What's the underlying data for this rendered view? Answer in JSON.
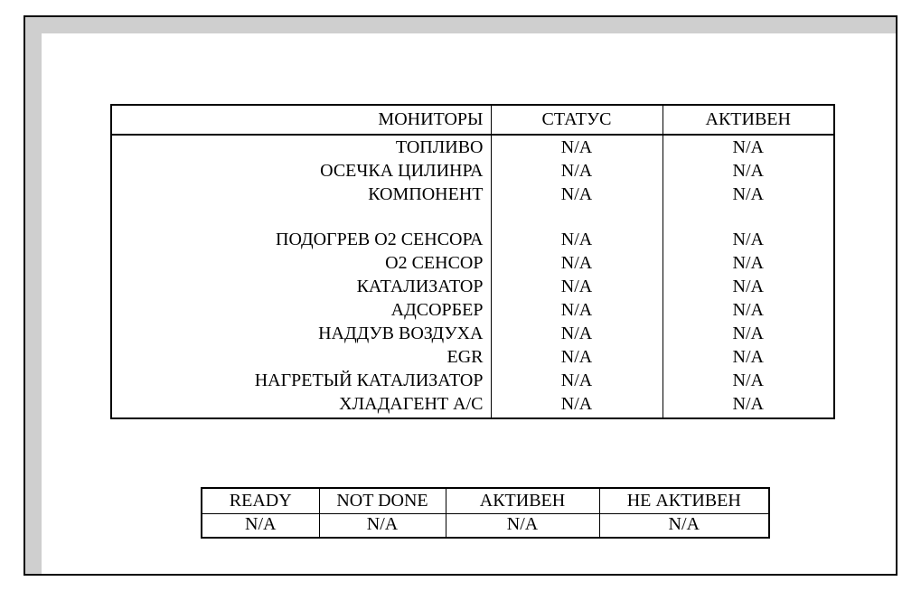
{
  "monitors": {
    "headers": {
      "name": "МОНИТОРЫ",
      "status": "СТАТУС",
      "active": "АКТИВЕН"
    },
    "rows_group1": [
      {
        "name": "ТОПЛИВО",
        "status": "N/A",
        "active": "N/A"
      },
      {
        "name": "ОСЕЧКА ЦИЛИНРА",
        "status": "N/A",
        "active": "N/A"
      },
      {
        "name": "КОМПОНЕНТ",
        "status": "N/A",
        "active": "N/A"
      }
    ],
    "rows_group2": [
      {
        "name": "ПОДОГРЕВ О2 СЕНСОРА",
        "status": "N/A",
        "active": "N/A"
      },
      {
        "name": "О2 СЕНСОР",
        "status": "N/A",
        "active": "N/A"
      },
      {
        "name": "КАТАЛИЗАТОР",
        "status": "N/A",
        "active": "N/A"
      },
      {
        "name": "АДСОРБЕР",
        "status": "N/A",
        "active": "N/A"
      },
      {
        "name": "НАДДУВ ВОЗДУХА",
        "status": "N/A",
        "active": "N/A"
      },
      {
        "name": "EGR",
        "status": "N/A",
        "active": "N/A"
      },
      {
        "name": "НАГРЕТЫЙ КАТАЛИЗАТОР",
        "status": "N/A",
        "active": "N/A"
      },
      {
        "name": "ХЛАДАГЕНТ А/С",
        "status": "N/A",
        "active": "N/A"
      }
    ]
  },
  "summary": {
    "headers": {
      "ready": "READY",
      "not_done": "NOT DONE",
      "active": "АКТИВЕН",
      "inactive": "НЕ АКТИВЕН"
    },
    "values": {
      "ready": "N/A",
      "not_done": "N/A",
      "active": "N/A",
      "inactive": "N/A"
    }
  }
}
